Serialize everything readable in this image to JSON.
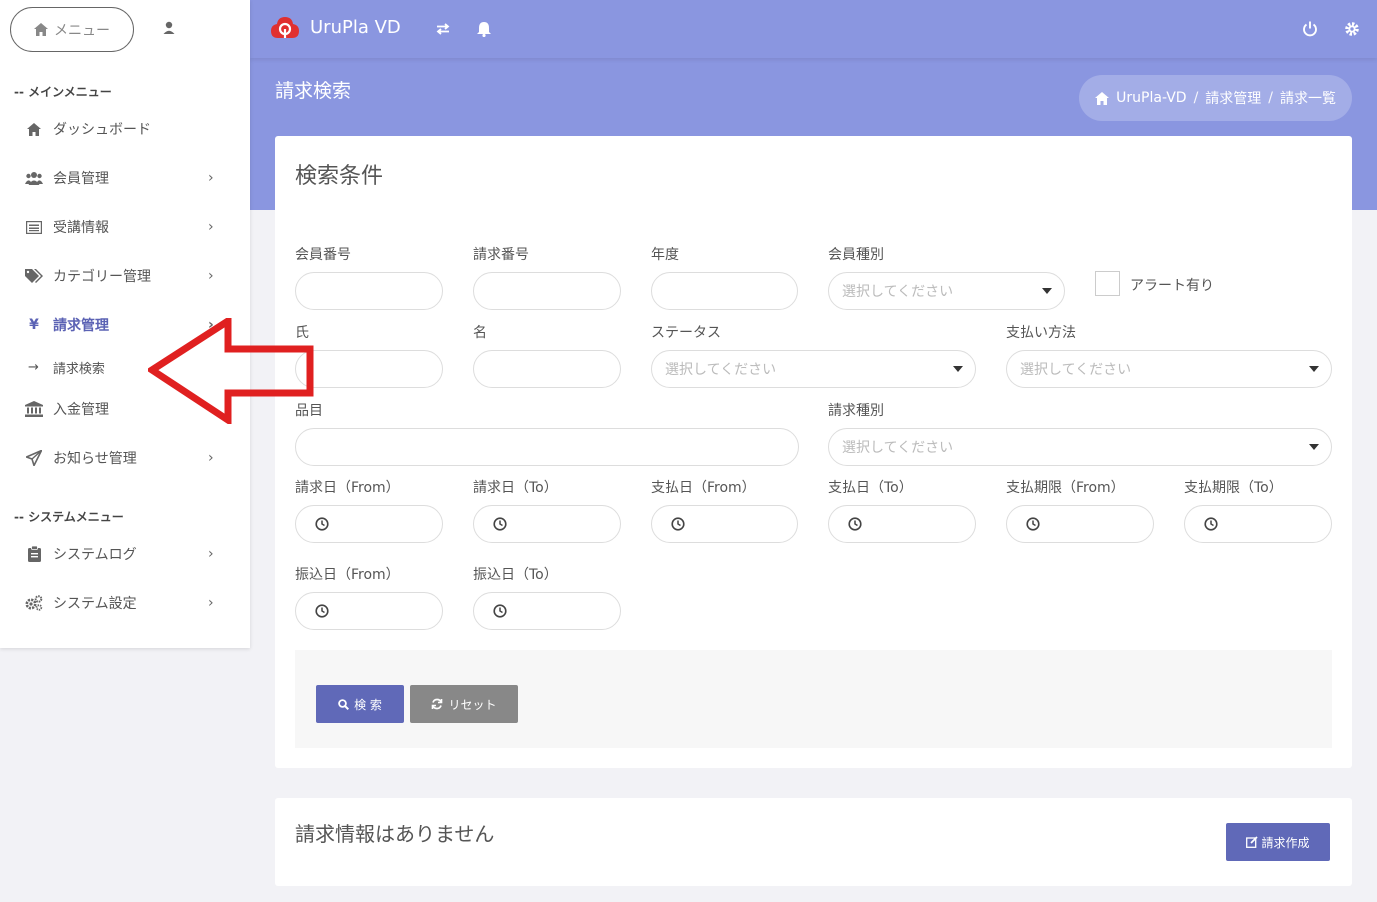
{
  "colors": {
    "accent": "#5b62b4",
    "header_bg": "#8a96e0",
    "arrow": "#e02020"
  },
  "sidebar": {
    "menu_label": "メニュー",
    "main_section": "-- メインメニュー",
    "system_section": "-- システムメニュー",
    "items": [
      {
        "label": "ダッシュボード",
        "icon": "home-icon"
      },
      {
        "label": "会員管理",
        "icon": "users-icon"
      },
      {
        "label": "受講情報",
        "icon": "list-icon"
      },
      {
        "label": "カテゴリー管理",
        "icon": "tags-icon"
      },
      {
        "label": "請求管理",
        "icon": "yen-icon"
      },
      {
        "label": "入金管理",
        "icon": "bank-icon"
      },
      {
        "label": "お知らせ管理",
        "icon": "send-icon"
      },
      {
        "label": "システムログ",
        "icon": "clipboard-icon"
      },
      {
        "label": "システム設定",
        "icon": "cogs-icon"
      }
    ],
    "sub_item": {
      "arrow": "→",
      "label": "請求検索"
    }
  },
  "header": {
    "app_name": "UruPla VD"
  },
  "page": {
    "title": "請求検索",
    "breadcrumb": [
      "UruPla-VD",
      "請求管理",
      "請求一覧"
    ],
    "breadcrumb_sep": "/"
  },
  "search": {
    "title": "検索条件",
    "fields": {
      "member_no": "会員番号",
      "invoice_no": "請求番号",
      "year": "年度",
      "member_type": "会員種別",
      "alert": "アラート有り",
      "last_name": "氏",
      "first_name": "名",
      "status": "ステータス",
      "payment_method": "支払い方法",
      "item": "品目",
      "invoice_type": "請求種別",
      "invoice_from": "請求日（From）",
      "invoice_to": "請求日（To）",
      "paid_from": "支払日（From）",
      "paid_to": "支払日（To）",
      "due_from": "支払期限（From）",
      "due_to": "支払期限（To）",
      "transfer_from": "振込日（From）",
      "transfer_to": "振込日（To）"
    },
    "select_placeholder": "選択してください",
    "search_button": "検 索",
    "reset_button": "リセット"
  },
  "result": {
    "empty_text": "請求情報はありません",
    "create_button": "請求作成"
  }
}
